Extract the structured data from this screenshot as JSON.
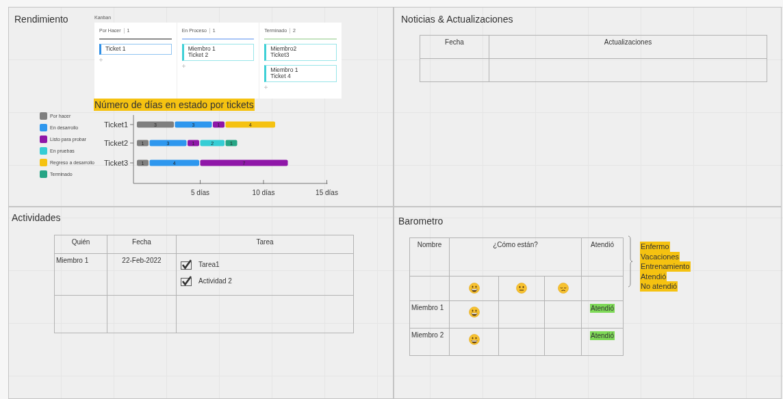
{
  "rendimiento": {
    "title": "Rendimiento",
    "kanban": {
      "label": "Kanban",
      "columns": [
        {
          "title": "Por Hacer",
          "count": "1",
          "color": "#8c8c8c",
          "cards": [
            {
              "text": "Ticket 1",
              "color": "#2f8fe6"
            }
          ]
        },
        {
          "title": "En Proceso",
          "count": "1",
          "color": "#a8c5f7",
          "cards": [
            {
              "text": "Miembro 1\nTicket 2",
              "color": "#3fd0d6"
            }
          ]
        },
        {
          "title": "Terminado",
          "count": "2",
          "color": "#c4e3bf",
          "cards": [
            {
              "text": "Miembro2\nTicket3",
              "color": "#3fd0d6"
            },
            {
              "text": "Miembro 1\nTicket 4",
              "color": "#3fd0d6"
            }
          ]
        }
      ]
    },
    "chart_data": {
      "type": "bar",
      "orientation": "horizontal",
      "stacked": true,
      "data_labels": true,
      "title": "Número de días en estado por tickets",
      "categories": [
        "Ticket1",
        "Ticket2",
        "Ticket3"
      ],
      "xlim": [
        0,
        15
      ],
      "xticks": [
        {
          "value": 5,
          "label": "5 días"
        },
        {
          "value": 10,
          "label": "10 días"
        },
        {
          "value": 15,
          "label": "15 días"
        }
      ],
      "series": [
        {
          "name": "Por hacer",
          "color": "#7f7f7f",
          "values": [
            3,
            1,
            1
          ]
        },
        {
          "name": "En desarrollo",
          "color": "#2e97ee",
          "values": [
            3,
            3,
            4
          ]
        },
        {
          "name": "Listo para probar",
          "color": "#8f17a8",
          "values": [
            1,
            1,
            7
          ]
        },
        {
          "name": "En pruebas",
          "color": "#35cdd5",
          "values": [
            null,
            2,
            null
          ]
        },
        {
          "name": "Regreso a desarrollo",
          "color": "#f5c211",
          "values": [
            4,
            null,
            null
          ]
        },
        {
          "name": "Terminado",
          "color": "#26a585",
          "values": [
            null,
            1,
            null
          ]
        }
      ]
    }
  },
  "noticias": {
    "title": "Noticias & Actualizaciones",
    "columns": [
      "Fecha",
      "Actualizaciones"
    ]
  },
  "actividades": {
    "title": "Actividades",
    "columns": [
      "Quién",
      "Fecha",
      "Tarea"
    ],
    "rows": [
      {
        "who": "Miembro 1",
        "date": "22-Feb-2022",
        "tasks": [
          {
            "label": "Tarea1",
            "checked": true
          },
          {
            "label": "Actividad 2",
            "checked": true
          }
        ]
      }
    ]
  },
  "barometro": {
    "title": "Barometro",
    "columns": {
      "name": "Nombre",
      "mood": "¿Cómo están?",
      "attended": "Atendió"
    },
    "moods": [
      {
        "kind": "happy"
      },
      {
        "kind": "neutral"
      },
      {
        "kind": "sad"
      }
    ],
    "rows": [
      {
        "name": "Miembro 1",
        "mood": {
          "kind": "happy"
        },
        "attended": "Atendió"
      },
      {
        "name": "Miembro 2",
        "mood": {
          "kind": "happy"
        },
        "attended": "Atendió"
      }
    ],
    "legend": [
      "Enfermo",
      "Vacaciones",
      "Entrenamiento",
      "Atendió",
      "No atendió"
    ]
  }
}
